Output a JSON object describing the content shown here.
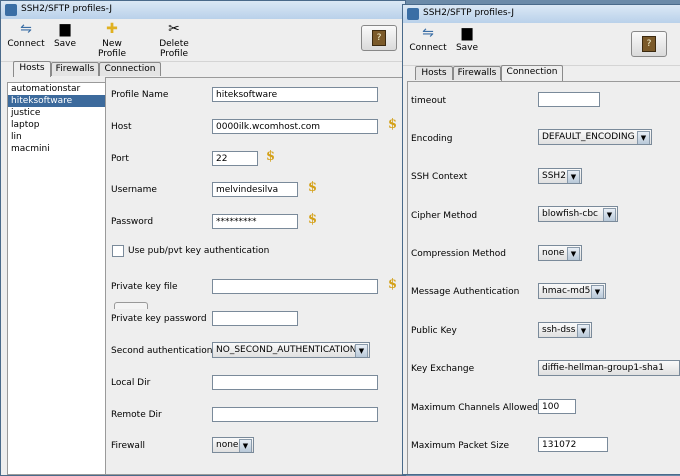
{
  "left_window": {
    "title": "SSH2/SFTP profiles-J",
    "toolbar": {
      "connect": "Connect",
      "save": "Save",
      "new_profile": "New Profile",
      "delete_profile": "Delete Profile"
    },
    "tabs": [
      "Hosts",
      "Firewalls",
      "Connection"
    ],
    "active_tab": "Hosts",
    "hosts": [
      "automationstar",
      "hiteksoftware",
      "justice",
      "laptop",
      "lin",
      "macmini"
    ],
    "selected_host": "hiteksoftware",
    "form": {
      "profile_name_label": "Profile Name",
      "profile_name": "hiteksoftware",
      "host_label": "Host",
      "host": "0000ilk.wcomhost.com",
      "port_label": "Port",
      "port": "22",
      "username_label": "Username",
      "username": "melvindesilva",
      "password_label": "Password",
      "password": "*********",
      "pubkey_label": "Use pub/pvt key authentication",
      "private_key_file_label": "Private key file",
      "private_key_file": "",
      "private_key_password_label": "Private key password",
      "private_key_password": "",
      "second_auth_label": "Second authentication",
      "second_auth": "NO_SECOND_AUTHENTICATION",
      "local_dir_label": "Local Dir",
      "local_dir": "",
      "remote_dir_label": "Remote Dir",
      "remote_dir": "",
      "firewall_label": "Firewall",
      "firewall": "none"
    }
  },
  "right_window": {
    "title": "SSH2/SFTP profiles-J",
    "toolbar": {
      "connect": "Connect",
      "save": "Save"
    },
    "tabs": [
      "Hosts",
      "Firewalls",
      "Connection"
    ],
    "active_tab": "Connection",
    "form": {
      "timeout_label": "timeout",
      "timeout": "",
      "encoding_label": "Encoding",
      "encoding": "DEFAULT_ENCODING",
      "ssh_context_label": "SSH Context",
      "ssh_context": "SSH2",
      "cipher_label": "Cipher Method",
      "cipher": "blowfish-cbc",
      "compression_label": "Compression Method",
      "compression": "none",
      "mac_label": "Message Authentication",
      "mac": "hmac-md5",
      "public_key_label": "Public Key",
      "public_key": "ssh-dss",
      "kex_label": "Key Exchange",
      "kex": "diffie-hellman-group1-sha1",
      "max_channels_label": "Maximum Channels Allowed",
      "max_channels": "100",
      "max_packet_label": "Maximum Packet Size",
      "max_packet": "131072"
    }
  },
  "icons": {
    "connect": "connect-icon",
    "save": "floppy-icon",
    "new_profile": "new-profile-icon",
    "delete": "scissors-icon",
    "help": "help-book-icon",
    "dollar": "dollar-variable-icon"
  },
  "colors": {
    "selection": "#3c6a9c",
    "title_bar": "#c9dcef",
    "dollar": "#d4a017"
  }
}
